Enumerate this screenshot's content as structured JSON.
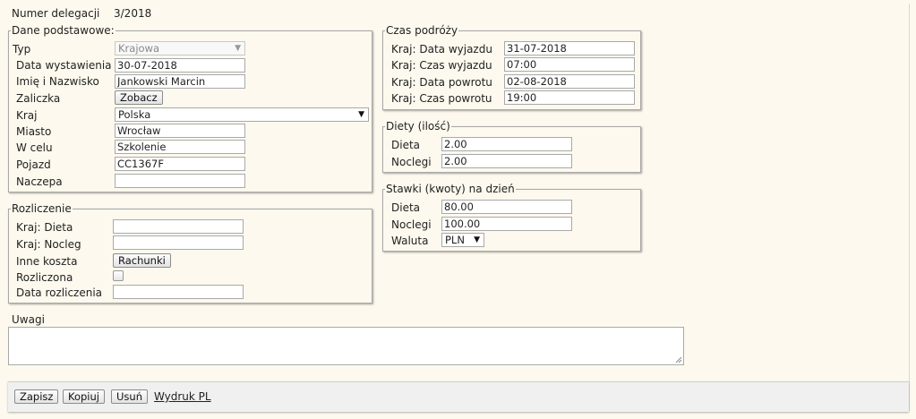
{
  "header": {
    "label": "Numer delegacji",
    "value": "3/2018"
  },
  "basic": {
    "legend": "Dane podstawowe:",
    "type_label": "Typ",
    "type_value": "Krajowa",
    "issue_date_label": "Data wystawienia",
    "issue_date": "30-07-2018",
    "name_label": "Imię i Nazwisko",
    "name": "Jankowski Marcin",
    "advance_label": "Zaliczka",
    "advance_button": "Zobacz",
    "country_label": "Kraj",
    "country": "Polska",
    "city_label": "Miasto",
    "city": "Wrocław",
    "purpose_label": "W celu",
    "purpose": "Szkolenie",
    "vehicle_label": "Pojazd",
    "vehicle": "CC1367F",
    "trailer_label": "Naczepa",
    "trailer": ""
  },
  "settlement": {
    "legend": "Rozliczenie",
    "diet_label": "Kraj: Dieta",
    "diet": "",
    "lodging_label": "Kraj: Nocleg",
    "lodging": "",
    "other_label": "Inne koszta",
    "other_button": "Rachunki",
    "settled_label": "Rozliczona",
    "settle_date_label": "Data rozliczenia",
    "settle_date": ""
  },
  "travel": {
    "legend": "Czas podróży",
    "dep_date_label": "Kraj: Data wyjazdu",
    "dep_date": "31-07-2018",
    "dep_time_label": "Kraj: Czas wyjazdu",
    "dep_time": "07:00",
    "ret_date_label": "Kraj: Data powrotu",
    "ret_date": "02-08-2018",
    "ret_time_label": "Kraj: Czas powrotu",
    "ret_time": "19:00"
  },
  "diets": {
    "legend": "Diety (ilość)",
    "diet_label": "Dieta",
    "diet": "2.00",
    "lodging_label": "Noclegi",
    "lodging": "2.00"
  },
  "rates": {
    "legend": "Stawki (kwoty) na dzień",
    "diet_label": "Dieta",
    "diet": "80.00",
    "lodging_label": "Noclegi",
    "lodging": "100.00",
    "currency_label": "Waluta",
    "currency": "PLN"
  },
  "notes": {
    "label": "Uwagi",
    "value": ""
  },
  "footer": {
    "save": "Zapisz",
    "copy": "Kopiuj",
    "delete": "Usuń",
    "print": "Wydruk PL"
  }
}
